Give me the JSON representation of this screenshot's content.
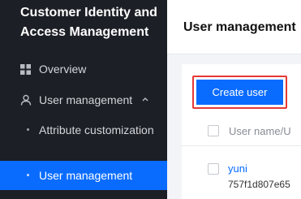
{
  "sidebar": {
    "product_title": "Customer Identity and Access Management",
    "overview": {
      "label": "Overview",
      "icon": "grid-icon"
    },
    "user_management_group": {
      "label": "User management",
      "icon": "user-icon",
      "expanded": true,
      "chevron": "chevron-up-icon"
    },
    "sub_items": [
      {
        "label": "Attribute customization",
        "active": false
      },
      {
        "label": "User management",
        "active": true
      }
    ]
  },
  "main": {
    "page_title": "User management",
    "create_button_label": "Create user",
    "table": {
      "columns": [
        "User name/U"
      ],
      "rows": [
        {
          "user_name": "yuni",
          "user_id": "757f1d807e65"
        }
      ]
    }
  },
  "colors": {
    "sidebar_bg": "#1c1f25",
    "accent": "#0a6cff",
    "highlight_border": "#e53935",
    "link": "#0a6cff"
  }
}
